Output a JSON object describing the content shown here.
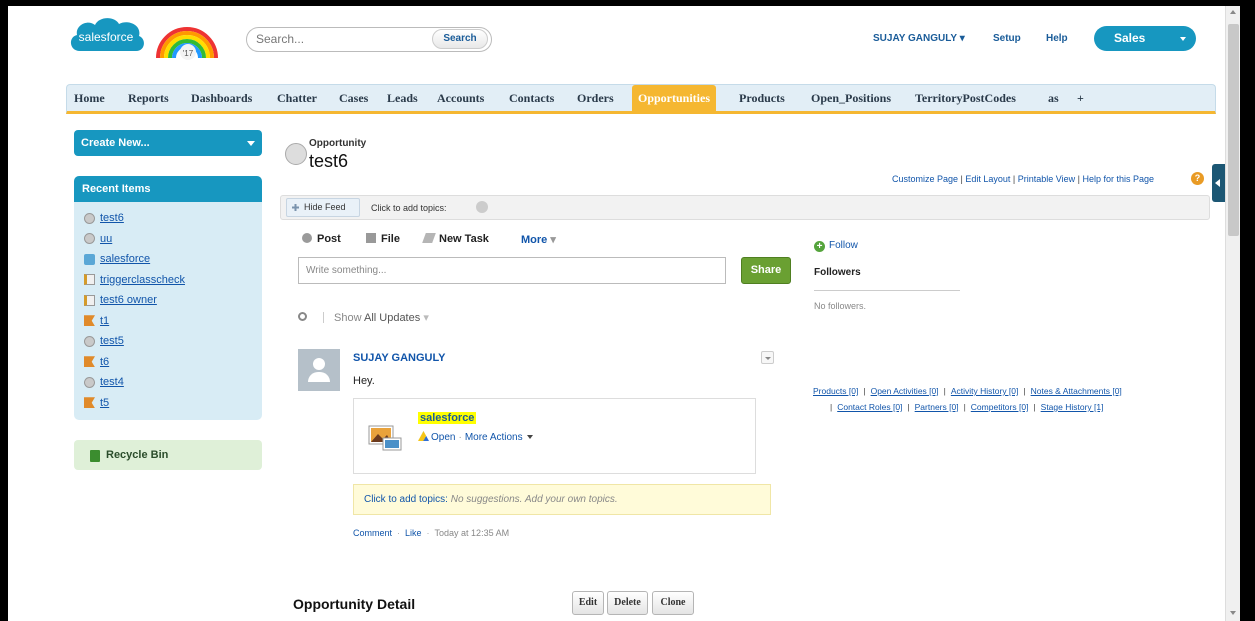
{
  "header": {
    "logo_text": "salesforce",
    "rainbow_badge": "'17",
    "search_placeholder": "Search...",
    "search_button": "Search",
    "user_name": "SUJAY GANGULY",
    "setup_label": "Setup",
    "help_label": "Help",
    "app_name": "Sales"
  },
  "tabs": [
    {
      "label": "Home"
    },
    {
      "label": "Reports"
    },
    {
      "label": "Dashboards"
    },
    {
      "label": "Chatter"
    },
    {
      "label": "Cases"
    },
    {
      "label": "Leads"
    },
    {
      "label": "Accounts"
    },
    {
      "label": "Contacts"
    },
    {
      "label": "Orders"
    },
    {
      "label": "Opportunities",
      "active": true
    },
    {
      "label": "Products"
    },
    {
      "label": "Open_Positions"
    },
    {
      "label": "TerritoryPostCodes"
    },
    {
      "label": "as"
    },
    {
      "label": "+"
    }
  ],
  "sidebar": {
    "create_new": "Create New...",
    "recent_title": "Recent Items",
    "recent_items": [
      {
        "label": "test6",
        "icon": "opportunity-icon"
      },
      {
        "label": "uu",
        "icon": "opportunity-icon"
      },
      {
        "label": "salesforce",
        "icon": "account-icon"
      },
      {
        "label": "triggerclasscheck",
        "icon": "apex-class-icon"
      },
      {
        "label": "test6 owner",
        "icon": "apex-class-icon"
      },
      {
        "label": "t1",
        "icon": "custom-object-icon"
      },
      {
        "label": "test5",
        "icon": "opportunity-icon"
      },
      {
        "label": "t6",
        "icon": "custom-object-icon"
      },
      {
        "label": "test4",
        "icon": "opportunity-icon"
      },
      {
        "label": "t5",
        "icon": "custom-object-icon"
      }
    ],
    "recycle_bin": "Recycle Bin"
  },
  "record": {
    "type": "Opportunity",
    "name": "test6",
    "page_links": [
      "Customize Page",
      "Edit Layout",
      "Printable View",
      "Help for this Page"
    ]
  },
  "feedbar": {
    "hide_feed": "Hide Feed",
    "add_topics": "Click to add topics:"
  },
  "publisher": {
    "post": "Post",
    "file": "File",
    "new_task": "New Task",
    "more": "More",
    "input_placeholder": "Write something...",
    "share": "Share"
  },
  "follow": {
    "follow_label": "Follow",
    "followers_title": "Followers",
    "no_followers": "No followers."
  },
  "filter": {
    "show_prefix": "Show",
    "show_value": "All Updates"
  },
  "feed_item": {
    "author": "SUJAY GANGULY",
    "body": "Hey.",
    "attachment_name": "salesforce",
    "attachment_open": "Open",
    "attachment_more": "More Actions",
    "topics_label": "Click to add topics:",
    "topics_hint": "No suggestions. Add your own topics.",
    "comment": "Comment",
    "like": "Like",
    "timestamp": "Today at 12:35 AM"
  },
  "related_links": {
    "row1": [
      "Products [0]",
      "Open Activities [0]",
      "Activity History [0]",
      "Notes & Attachments [0]"
    ],
    "row2": [
      "Contact Roles [0]",
      "Partners [0]",
      "Competitors [0]",
      "Stage History [1]"
    ]
  },
  "detail": {
    "title": "Opportunity Detail",
    "edit": "Edit",
    "delete": "Delete",
    "clone": "Clone"
  },
  "colors": {
    "brand_blue": "#1797c0",
    "active_tab": "#f5b731",
    "share_green": "#6aa032",
    "link_blue": "#1155aa",
    "highlight_yellow": "#ffff00"
  }
}
